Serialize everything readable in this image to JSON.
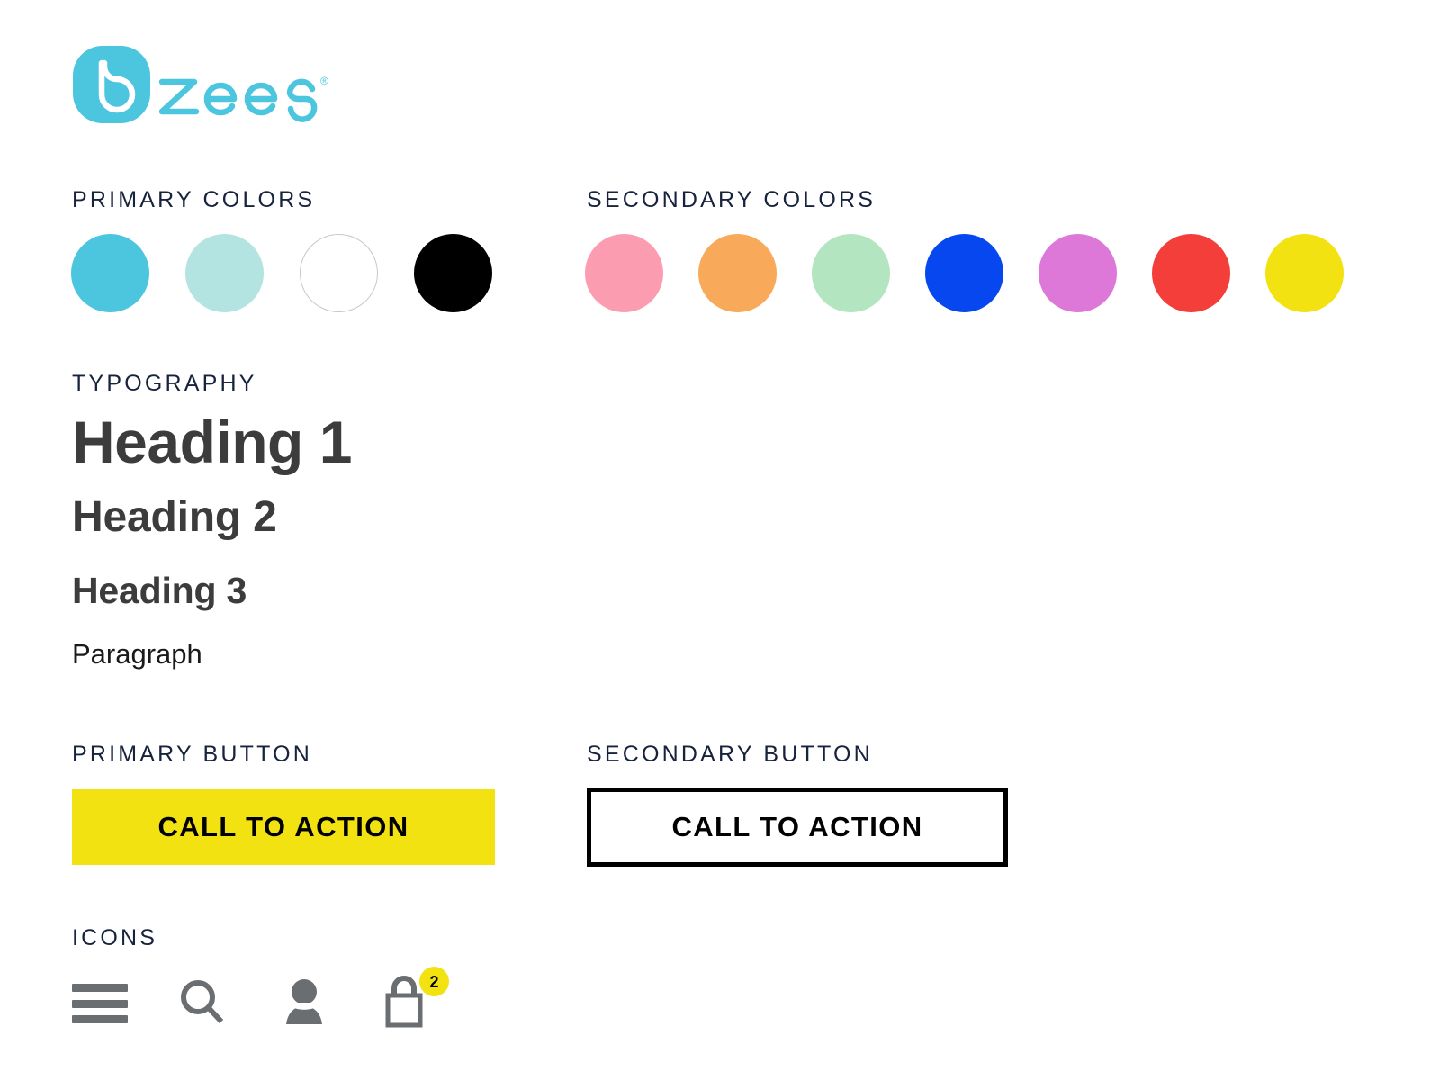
{
  "brand": {
    "logo_text": "zees",
    "logo_mark_letter": "B",
    "trademark_symbol": "®",
    "logo_color": "#4cc6de",
    "full_name": "Bzees"
  },
  "sections": {
    "primary_colors_label": "PRIMARY COLORS",
    "secondary_colors_label": "SECONDARY COLORS",
    "typography_label": "TYPOGRAPHY",
    "primary_button_label": "PRIMARY BUTTON",
    "secondary_button_label": "SECONDARY BUTTON",
    "icons_label": "ICONS"
  },
  "primary_colors": [
    {
      "name": "cyan",
      "hex": "#4cc6de",
      "outlined": false
    },
    {
      "name": "pale-aqua",
      "hex": "#b3e4e1",
      "outlined": false
    },
    {
      "name": "white",
      "hex": "#ffffff",
      "outlined": true
    },
    {
      "name": "black",
      "hex": "#000000",
      "outlined": false
    }
  ],
  "secondary_colors": [
    {
      "name": "pink",
      "hex": "#fb9cb0",
      "outlined": false
    },
    {
      "name": "orange",
      "hex": "#f9a95a",
      "outlined": false
    },
    {
      "name": "mint-green",
      "hex": "#b3e5c0",
      "outlined": false
    },
    {
      "name": "blue",
      "hex": "#0747f0",
      "outlined": false
    },
    {
      "name": "orchid",
      "hex": "#dd78d8",
      "outlined": false
    },
    {
      "name": "red",
      "hex": "#f43e3a",
      "outlined": false
    },
    {
      "name": "yellow",
      "hex": "#f2e211",
      "outlined": false
    }
  ],
  "typography": {
    "heading1": "Heading 1",
    "heading2": "Heading 2",
    "heading3": "Heading 3",
    "paragraph": "Paragraph",
    "text_color": "#3c3c3c"
  },
  "buttons": {
    "primary": {
      "label": "CALL TO ACTION",
      "background": "#f2e211",
      "text_color": "#000000"
    },
    "secondary": {
      "label": "CALL TO ACTION",
      "background": "#ffffff",
      "border_color": "#000000",
      "text_color": "#000000"
    }
  },
  "icons": [
    {
      "name": "hamburger-menu-icon",
      "color": "#6b6e70"
    },
    {
      "name": "search-icon",
      "color": "#6b6e70"
    },
    {
      "name": "account-icon",
      "color": "#6b6e70"
    },
    {
      "name": "shopping-bag-icon",
      "color": "#6b6e70",
      "badge_count": "2",
      "badge_color": "#f2e211"
    }
  ]
}
